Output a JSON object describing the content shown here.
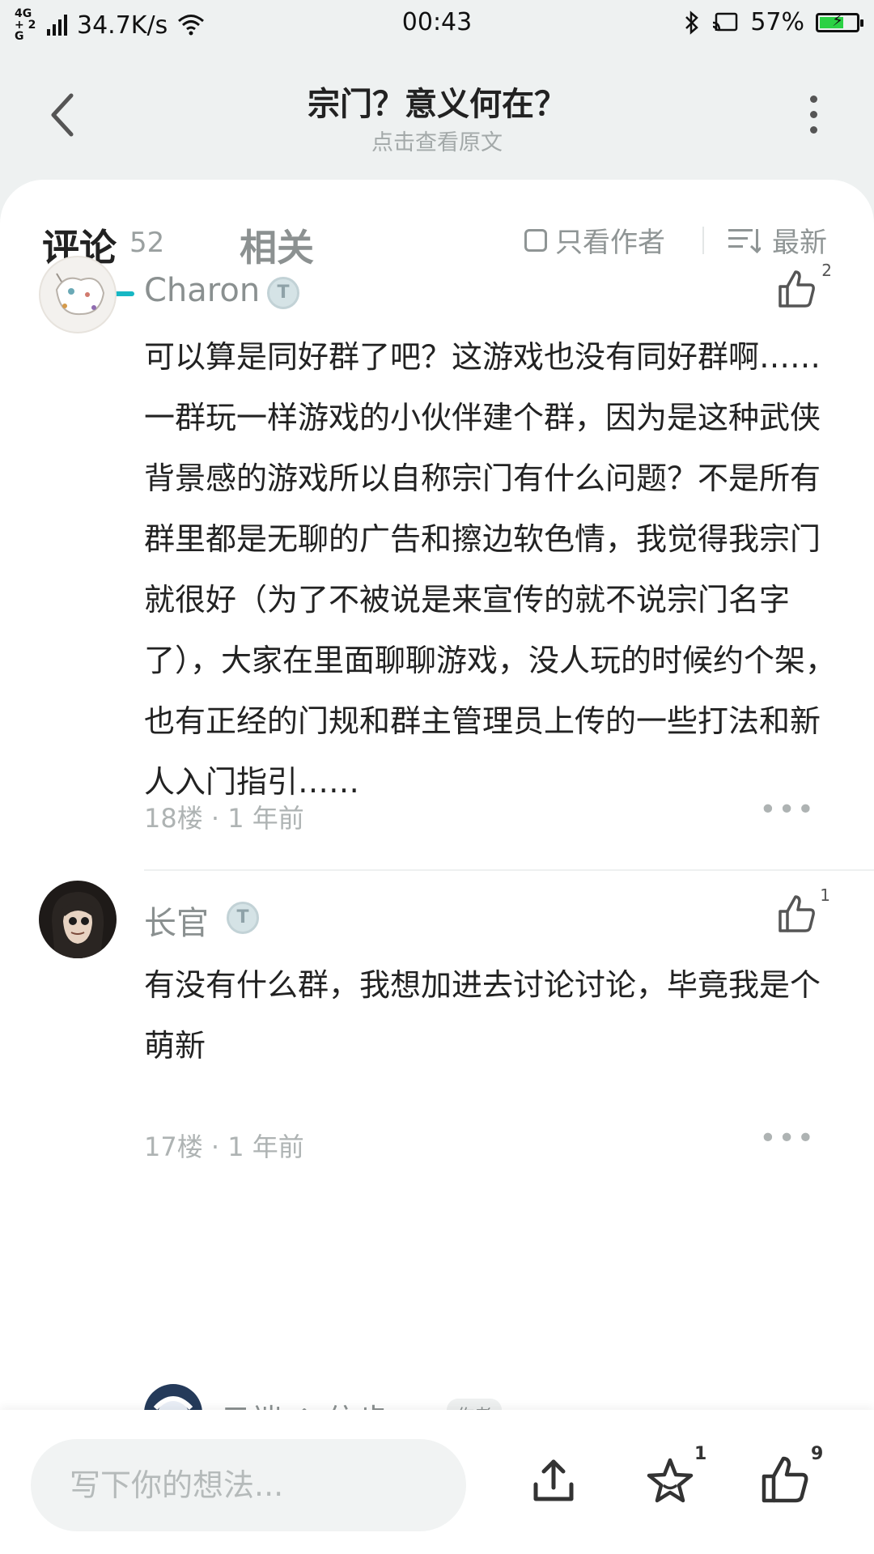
{
  "status_bar": {
    "network": "4G+ 2G",
    "speed": "34.7K/s",
    "time": "00:43",
    "battery": "57%"
  },
  "header": {
    "title": "宗门？意义何在？",
    "subtitle": "点击查看原文"
  },
  "tabs": {
    "comments_label": "评论",
    "comments_count": "52",
    "related_label": "相关",
    "author_only_label": "只看作者",
    "sort_label": "最新"
  },
  "comments": [
    {
      "username": "Charon",
      "badge": "T",
      "likes": "2",
      "body": "可以算是同好群了吧？这游戏也没有同好群啊……一群玩一样游戏的小伙伴建个群，因为是这种武侠背景感的游戏所以自称宗门有什么问题？不是所有群里都是无聊的广告和擦边软色情，我觉得我宗门就很好（为了不被说是来宣传的就不说宗门名字了），大家在里面聊聊游戏，没人玩的时候约个架，也有正经的门规和群主管理员上传的一些打法和新人入门指引……",
      "meta": "18楼 · 1 年前"
    },
    {
      "username": "长官",
      "badge": "T",
      "likes": "1",
      "body": "有没有什么群，我想加进去讨论讨论，毕竟我是个萌新",
      "meta": "17楼 · 1 年前"
    }
  ],
  "reply_preview": {
    "username": "云端 ↑ 信步",
    "author_tag": "作者"
  },
  "bottom_bar": {
    "input_placeholder": "写下你的想法...",
    "favorite_count": "1",
    "like_count": "9"
  },
  "colors": {
    "accent": "#17b7c4",
    "battery": "#2bd144"
  }
}
